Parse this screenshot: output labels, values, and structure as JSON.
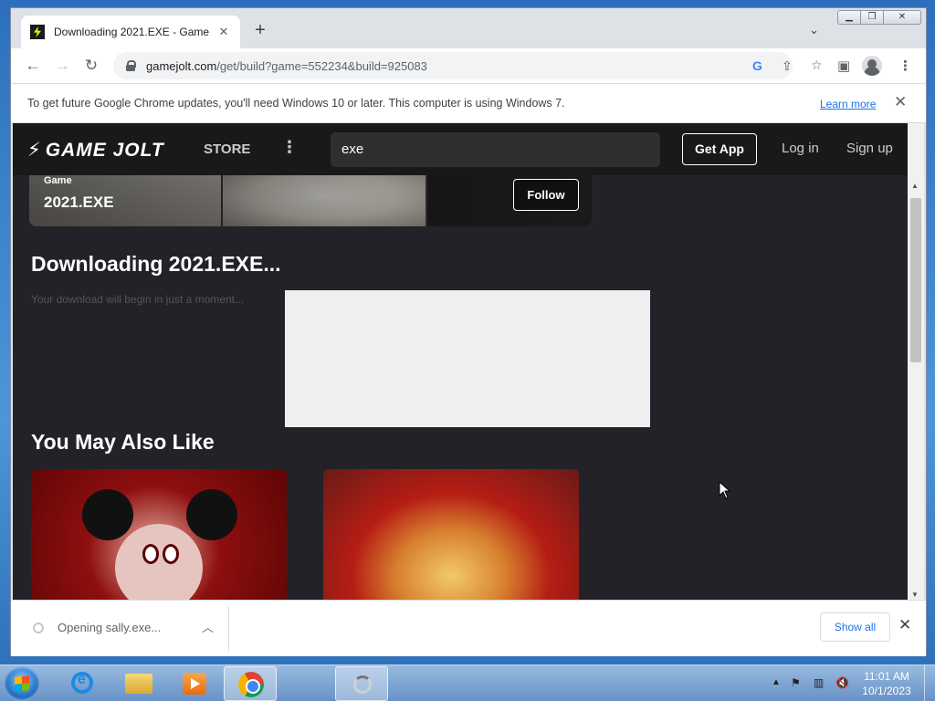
{
  "browser": {
    "tab_title": "Downloading 2021.EXE - Game Jolt",
    "tab_close": "✕",
    "new_tab": "+",
    "url_host": "gamejolt.com",
    "url_path": "/get/build?game=552234&build=925083",
    "infobar": {
      "message": "To get future Google Chrome updates, you'll need Windows 10 or later. This computer is using Windows 7.",
      "link": "Learn more",
      "close": "✕"
    },
    "icons": [
      "back-icon",
      "forward-icon",
      "reload-icon",
      "lock-icon",
      "google-icon",
      "share-icon",
      "star-icon",
      "side-panel-icon",
      "profile-icon",
      "menu-icon"
    ]
  },
  "site": {
    "logo": "GAME JOLT",
    "store": "STORE",
    "more": "⋮",
    "search_value": "exe",
    "get_app": "Get App",
    "login": "Log in",
    "signup": "Sign up",
    "banner": {
      "kind": "Game",
      "title": "2021.EXE",
      "follow": "Follow"
    },
    "download_title": "Downloading 2021.EXE...",
    "download_subtitle": "Your download will begin in just a moment...",
    "you_may_also_like": "You May Also Like"
  },
  "download_bar": {
    "item": "Opening sally.exe...",
    "show_all": "Show all",
    "close": "✕"
  },
  "taskbar": {
    "time": "11:01 AM",
    "date": "10/1/2023",
    "pinned": [
      "start-button",
      "internet-explorer",
      "file-explorer",
      "media-player",
      "chrome",
      "loading-app"
    ]
  },
  "colors": {
    "site_bg": "#232228",
    "site_header": "#191919",
    "link_blue": "#1a73e8"
  }
}
